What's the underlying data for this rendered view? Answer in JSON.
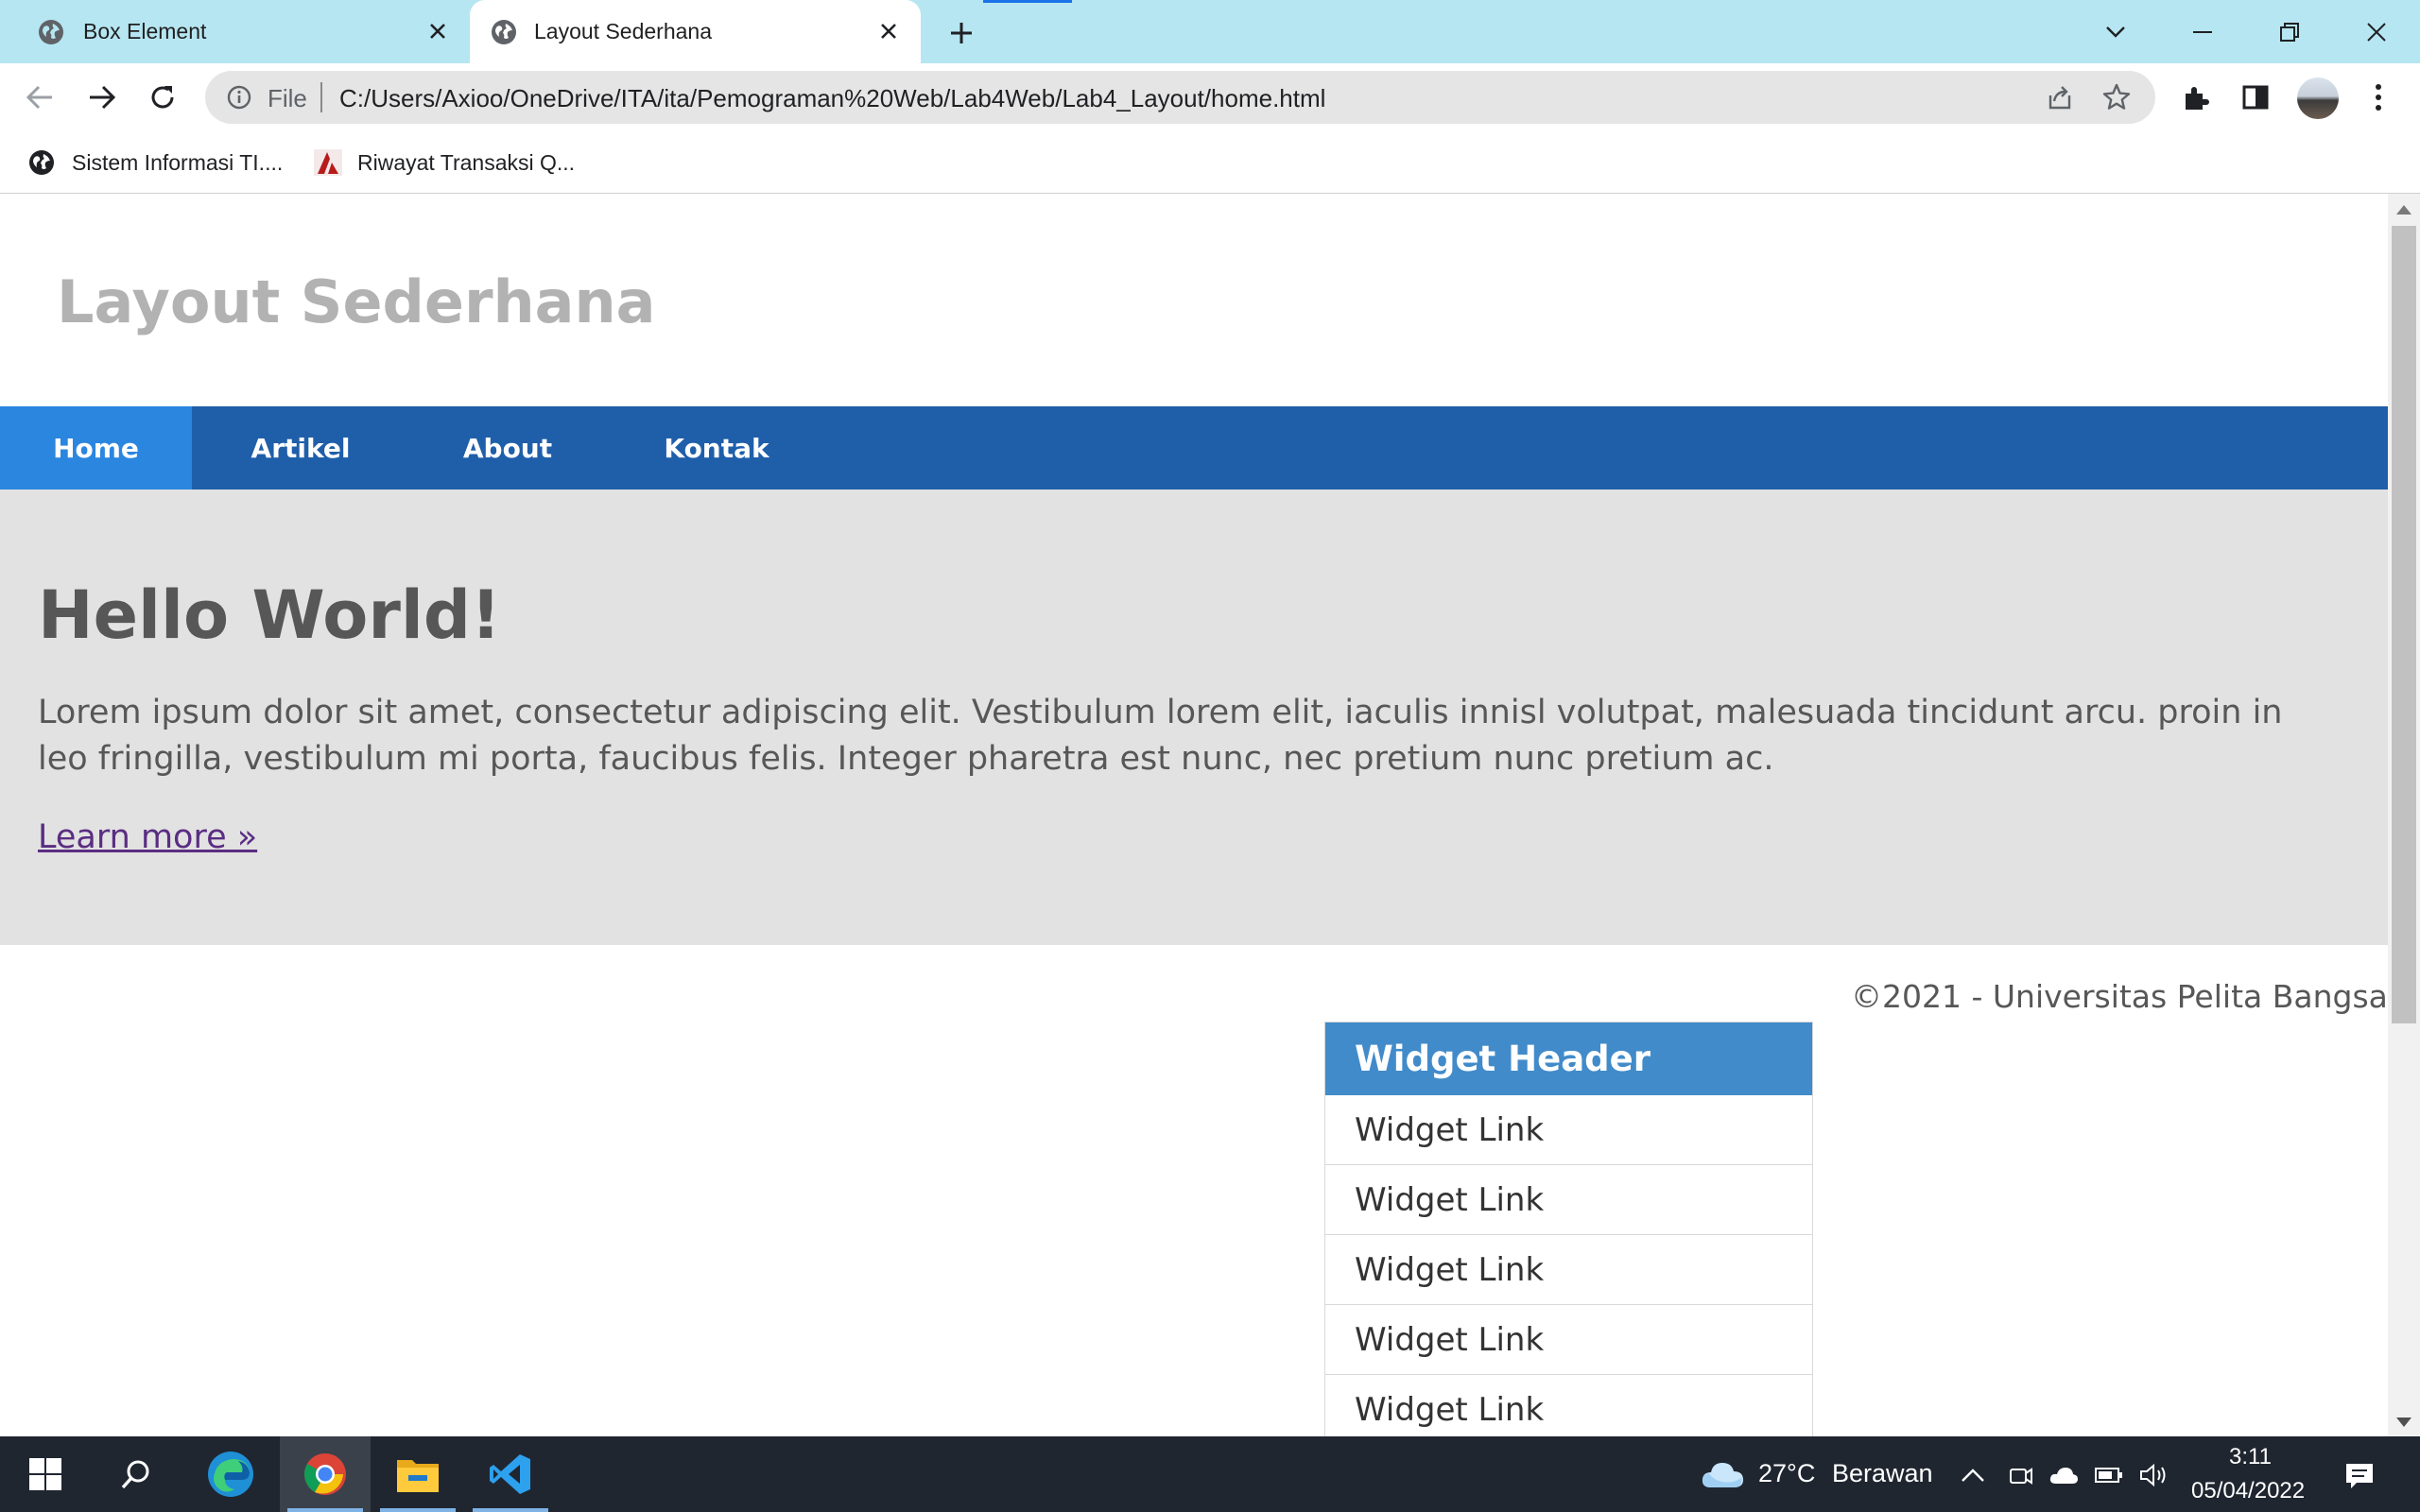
{
  "browser": {
    "tabs": [
      {
        "title": "Box Element",
        "active": false
      },
      {
        "title": "Layout Sederhana",
        "active": true
      }
    ],
    "address": {
      "scheme_label": "File",
      "url": "C:/Users/Axioo/OneDrive/ITA/ita/Pemograman%20Web/Lab4Web/Lab4_Layout/home.html"
    },
    "bookmarks": [
      {
        "label": "Sistem Informasi TI...."
      },
      {
        "label": "Riwayat Transaksi Q..."
      }
    ]
  },
  "page": {
    "site_title": "Layout Sederhana",
    "nav": [
      {
        "label": "Home",
        "active": true
      },
      {
        "label": "Artikel",
        "active": false
      },
      {
        "label": "About",
        "active": false
      },
      {
        "label": "Kontak",
        "active": false
      }
    ],
    "hero": {
      "title": "Hello World!",
      "text": "Lorem ipsum dolor sit amet, consectetur adipiscing elit. Vestibulum lorem elit, iaculis innisl volutpat, malesuada tincidunt arcu. proin in leo fringilla, vestibulum mi porta, faucibus felis. Integer pharetra est nunc, nec pretium nunc pretium ac.",
      "link_label": "Learn more »"
    },
    "footer_text": "©2021 - Universitas Pelita Bangsa",
    "widget": {
      "header": "Widget Header",
      "links": [
        "Widget Link",
        "Widget Link",
        "Widget Link",
        "Widget Link",
        "Widget Link"
      ]
    },
    "colors": {
      "nav_bg": "#1f5faa",
      "nav_active": "#2b86e0",
      "hero_bg": "#e2e2e2",
      "widget_header": "#428bca"
    }
  },
  "taskbar": {
    "apps": [
      "start-icon",
      "search-icon",
      "edge-icon",
      "chrome-icon",
      "file-explorer-icon",
      "vscode-icon"
    ],
    "weather": {
      "temp": "27°C",
      "condition": "Berawan"
    },
    "clock": {
      "time": "3:11",
      "date": "05/04/2022"
    }
  }
}
